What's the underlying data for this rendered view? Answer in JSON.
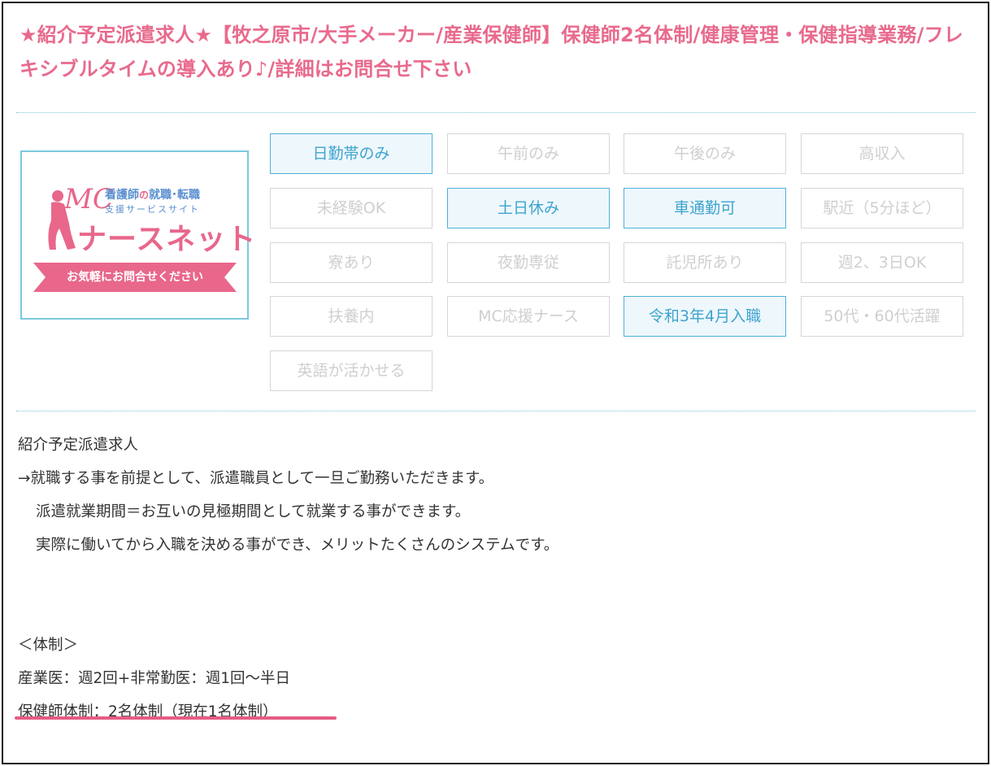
{
  "title": "★紹介予定派遣求人★【牧之原市/大手メーカー/産業保健師】保健師2名体制/健康管理・保健指導業務/フレキシブルタイムの導入あり♪/詳細はお問合せ下さい",
  "logo": {
    "mc": "MC",
    "tagline_a": "看護師",
    "tagline_on": "の",
    "tagline_b": "就職･転職",
    "subtitle": "支援サービスサイト",
    "brand": "ナースネット",
    "ribbon": "お気軽にお問合せください"
  },
  "tags": [
    {
      "label": "日勤帯のみ",
      "active": true
    },
    {
      "label": "午前のみ",
      "active": false
    },
    {
      "label": "午後のみ",
      "active": false
    },
    {
      "label": "高収入",
      "active": false
    },
    {
      "label": "未経験OK",
      "active": false
    },
    {
      "label": "土日休み",
      "active": true
    },
    {
      "label": "車通勤可",
      "active": true
    },
    {
      "label": "駅近（5分ほど）",
      "active": false
    },
    {
      "label": "寮あり",
      "active": false
    },
    {
      "label": "夜勤専従",
      "active": false
    },
    {
      "label": "託児所あり",
      "active": false
    },
    {
      "label": "週2、3日OK",
      "active": false
    },
    {
      "label": "扶養内",
      "active": false
    },
    {
      "label": "MC応援ナース",
      "active": false
    },
    {
      "label": "令和3年4月入職",
      "active": true
    },
    {
      "label": "50代・60代活躍",
      "active": false
    },
    {
      "label": "英語が活かせる",
      "active": false
    }
  ],
  "description": {
    "heading": "紹介予定派遣求人",
    "line1": "→就職する事を前提として、派遣職員として一旦ご勤務いただきます。",
    "line2": "派遣就業期間＝お互いの見極期間として就業する事ができます。",
    "line3": "実際に働いてから入職を決める事ができ、メリットたくさんのシステムです。"
  },
  "structure": {
    "heading": "＜体制＞",
    "doctors": "産業医：週2回+非常勤医：週1回～半日",
    "nurses": "保健師体制：2名体制（現在1名体制）"
  },
  "colors": {
    "title": "#e86a8c",
    "active_tag_text": "#3ea4cf",
    "active_tag_border": "#4fb0d8",
    "underline": "#e55c87",
    "logo_frame": "#7cc8e0"
  }
}
